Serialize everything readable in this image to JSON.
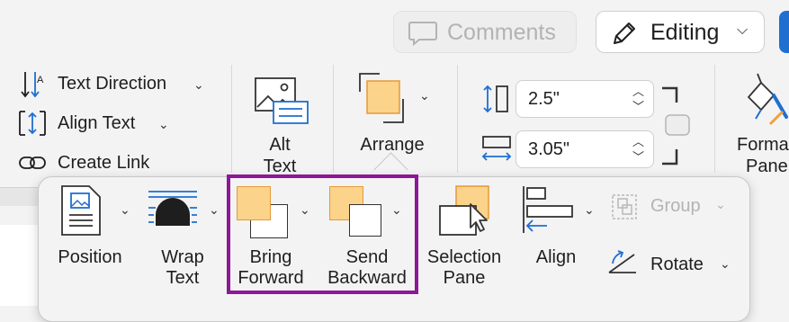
{
  "header": {
    "comments_label": "Comments",
    "editing_label": "Editing"
  },
  "ribbon": {
    "text_direction": "Text Direction",
    "align_text": "Align Text",
    "create_link": "Create Link",
    "alt_text_line1": "Alt",
    "alt_text_line2": "Text",
    "arrange": "Arrange",
    "height_value": "2.5\"",
    "width_value": "3.05\"",
    "format_pane_line1": "Forma",
    "format_pane_line2": "Pane"
  },
  "arrange_menu": {
    "position": "Position",
    "wrap_text_line1": "Wrap",
    "wrap_text_line2": "Text",
    "bring_forward_line1": "Bring",
    "bring_forward_line2": "Forward",
    "send_backward_line1": "Send",
    "send_backward_line2": "Backward",
    "selection_pane_line1": "Selection",
    "selection_pane_line2": "Pane",
    "align": "Align",
    "group": "Group",
    "rotate": "Rotate"
  },
  "colors": {
    "highlight_border": "#8d1796",
    "shape_fill": "#fbd38a",
    "shape_border": "#e59a37",
    "accent_blue": "#1f6fd1"
  }
}
